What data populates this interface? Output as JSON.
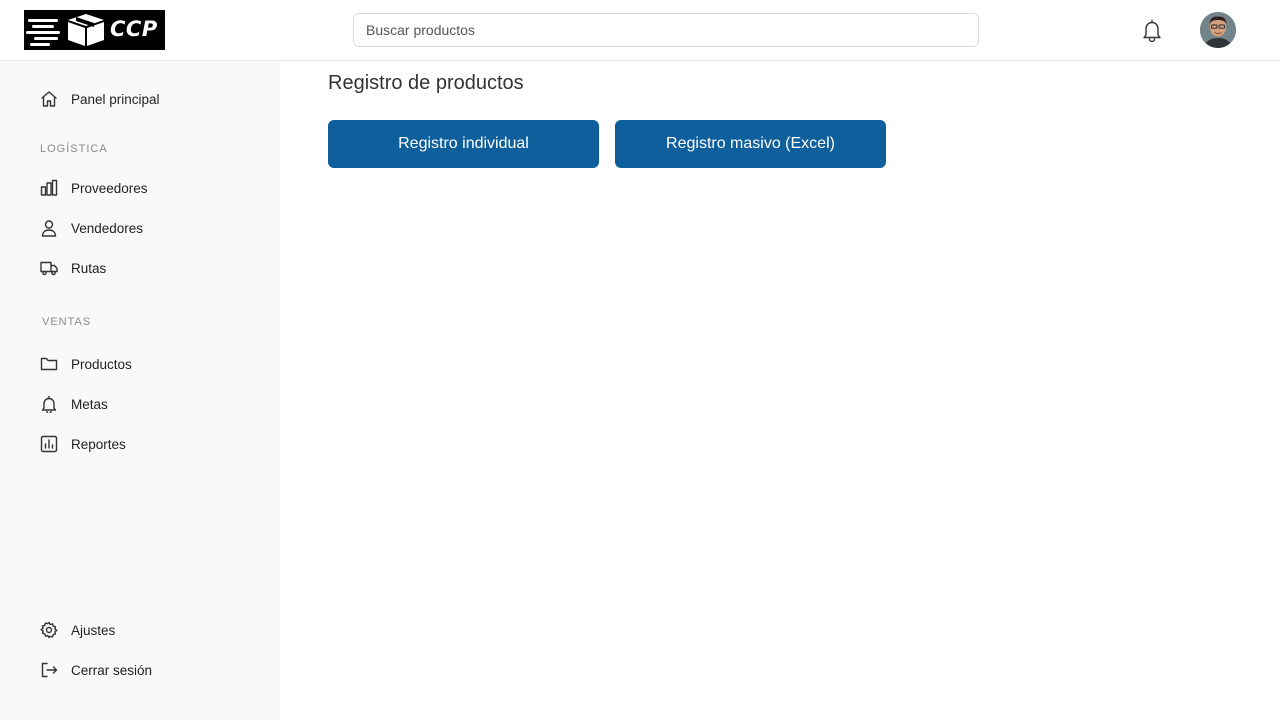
{
  "header": {
    "logo_text": "CCP",
    "search_placeholder": "Buscar productos",
    "notification_icon": "bell-icon",
    "avatar_icon": "user-avatar"
  },
  "sidebar": {
    "home": {
      "label": "Panel principal",
      "icon": "home-icon"
    },
    "sections": [
      {
        "title": "LOGÍSTICA",
        "items": [
          {
            "label": "Proveedores",
            "icon": "bar-chart-icon"
          },
          {
            "label": "Vendedores",
            "icon": "user-icon"
          },
          {
            "label": "Rutas",
            "icon": "truck-icon"
          }
        ]
      },
      {
        "title": "VENTAS",
        "items": [
          {
            "label": "Productos",
            "icon": "folder-icon"
          },
          {
            "label": "Metas",
            "icon": "bell-icon"
          },
          {
            "label": "Reportes",
            "icon": "report-icon"
          }
        ]
      }
    ],
    "footer": [
      {
        "label": "Ajustes",
        "icon": "gear-icon"
      },
      {
        "label": "Cerrar sesión",
        "icon": "logout-icon"
      }
    ]
  },
  "main": {
    "title": "Registro de productos",
    "buttons": [
      {
        "label": "Registro individual"
      },
      {
        "label": "Registro masivo (Excel)"
      }
    ]
  },
  "colors": {
    "primary": "#0f5f9c",
    "sidebar_bg": "#f9f9f9",
    "section_label": "#8b8b8b"
  }
}
